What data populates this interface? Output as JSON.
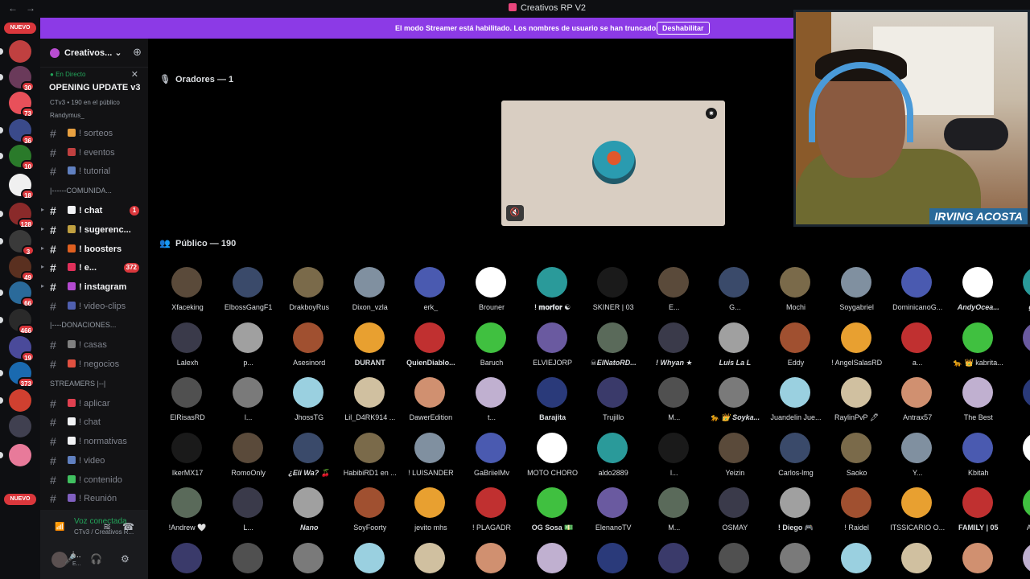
{
  "window": {
    "title": "Creativos RP V2",
    "back": "←",
    "forward": "→"
  },
  "banner": {
    "message": "El modo Streamer está habilitado. Los nombres de usuario se han truncado.",
    "button": "Deshabilitar"
  },
  "rail": {
    "new_label": "NUEVO",
    "badges": [
      "30",
      "73",
      "36",
      "10",
      "18",
      "128",
      "3",
      "49",
      "66",
      "466",
      "19",
      "373"
    ]
  },
  "server": {
    "name": "Creativos...",
    "chevron": "⌄",
    "invite_icon": "person-add-icon"
  },
  "event": {
    "status": "En Directo",
    "title": "OPENING UPDATE v3",
    "meta": "CTv3 • 190 en el público",
    "user": "Randymus_",
    "close": "✕"
  },
  "channels": [
    {
      "label": "! sorteos",
      "emoji": "#e8a040"
    },
    {
      "label": "! eventos",
      "emoji": "#c04040"
    },
    {
      "label": "! tutorial",
      "emoji": "#6080c0"
    },
    {
      "category": "|------COMUNIDA..."
    },
    {
      "label": "! chat",
      "emoji": "#f2f3f5",
      "bold": true,
      "badge": "1"
    },
    {
      "label": "! sugerenc...",
      "emoji": "#c0a040",
      "bold": true
    },
    {
      "label": "! boosters",
      "emoji": "#e06020",
      "bold": true
    },
    {
      "label": "! e...",
      "emoji": "#e0305a",
      "bold": true,
      "badge": "372"
    },
    {
      "label": "! instagram",
      "emoji": "#b44ad0",
      "bold": true
    },
    {
      "label": "! video-clips",
      "emoji": "#5060b0"
    },
    {
      "category": "|----DONACIONES..."
    },
    {
      "label": "! casas",
      "emoji": "#808080"
    },
    {
      "label": "! negocios",
      "emoji": "#e05040"
    },
    {
      "category": "STREAMERS |--|"
    },
    {
      "label": "! aplicar",
      "emoji": "#e04050"
    },
    {
      "label": "! chat",
      "emoji": "#f2f3f5"
    },
    {
      "label": "! normativas",
      "emoji": "#f2f3f5"
    },
    {
      "label": "! video",
      "emoji": "#6080c0"
    },
    {
      "label": "! contenido",
      "emoji": "#40c060"
    },
    {
      "label": "! Reunión",
      "emoji": "#8060c0"
    }
  ],
  "voice": {
    "status": "Voz conectada",
    "channel": "CTv3 / Creativos R...",
    "user": "i...",
    "user_sub": "E..."
  },
  "stage": {
    "speakers_header": "Oradores — 1",
    "audience_header": "Público — 190"
  },
  "audience": [
    [
      "Xfaceking",
      "ElbossGangF1",
      "DrakboyRus",
      "Dixon_vzla",
      "erk_",
      "Brouner",
      "! 𝐦𝐨𝐫𝐟𝐨𝐫 ☯",
      "SKINER | 03",
      "E...",
      "G...",
      "Mochi",
      "Soygabriel",
      "DominicanoG...",
      "AndyOcea...",
      "gam..."
    ],
    [
      "Lalexh",
      "p...",
      "Asesinord",
      "DURANT",
      "QuienDiablo...",
      "Baruch",
      "ELVIEJORP",
      "☠ElNatoRD...",
      "! Whyan ★",
      "Luis La L",
      "Eddy",
      "! AngelSalasRD",
      "a...",
      "🐆 👑 kabrita...",
      "Pa..."
    ],
    [
      "ElRisasRD",
      "l...",
      "JhossTG",
      "Lil_D4RK914 ...",
      "DawerEdition",
      "t...",
      "Barajita",
      "Trujillo",
      "M...",
      "🐆 👑 Soyka...",
      "Juandelin Jue...",
      "RaylinPvP 🖋",
      "Antrax57",
      "The Best",
      "C..."
    ],
    [
      "IkerMX17",
      "RomoOnly",
      "¿Eli Wa? 🍒",
      "HabibiRD1 en ...",
      "! LUISANDER",
      "GaBriielMv",
      "MOTO CHORO",
      "aldo2889",
      "l...",
      "Yeizin",
      "Carlos-lmg",
      "Saoko",
      "Y...",
      "Kbitah",
      "LAF..."
    ],
    [
      "!Andrew 🤍",
      "L...",
      "Nano",
      "SoyFoorty",
      "jevito mhs",
      "! PLAGADR",
      "OG Sosa 💵",
      "ElenanoTV",
      "M...",
      "OSMAY",
      "! Diego 🎮",
      "! Raidel",
      "ITSSICARIO O...",
      "FAMILY | 05",
      "AK_C..."
    ],
    [
      "",
      "",
      "",
      "",
      "",
      "",
      "",
      "",
      "",
      "",
      "",
      "",
      "",
      "",
      ""
    ]
  ],
  "webcam": {
    "name": "IRVING ACOSTA"
  }
}
